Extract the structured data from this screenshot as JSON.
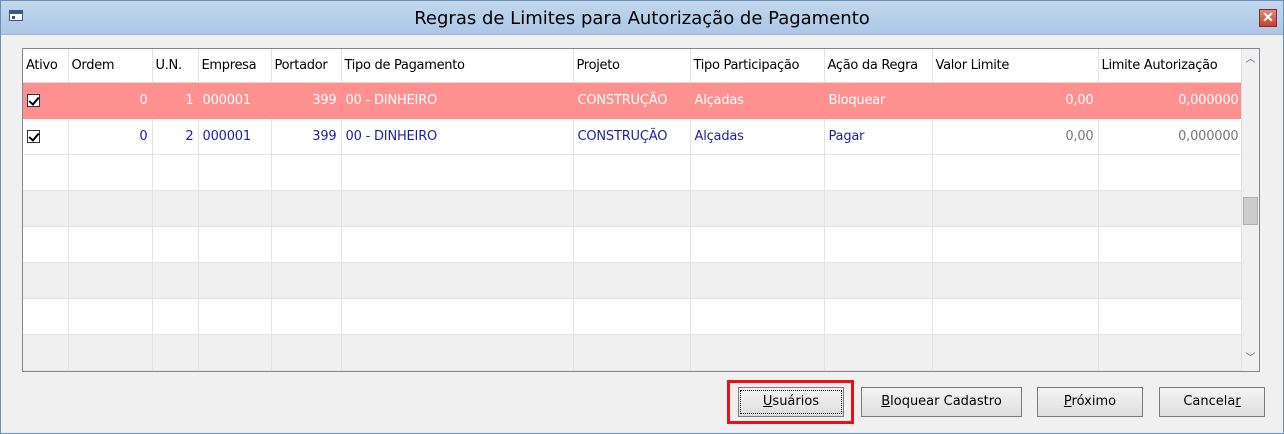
{
  "window": {
    "title": "Regras de Limites para Autorização de Pagamento",
    "close_glyph": "✕"
  },
  "grid": {
    "columns": [
      "Ativo",
      "Ordem",
      "U.N.",
      "Empresa",
      "Portador",
      "Tipo de Pagamento",
      "Projeto",
      "Tipo Participação",
      "Ação da Regra",
      "Valor Limite",
      "Limite Autorização"
    ],
    "rows": [
      {
        "ativo": true,
        "ordem": "0",
        "un": "1",
        "empresa": "000001",
        "portador": "399",
        "tipo_pagamento": "00 - DINHEIRO",
        "projeto": "CONSTRUÇÃO",
        "tipo_participacao": "Alçadas",
        "acao_regra": "Bloquear",
        "valor_limite": "0,00",
        "limite_autorizacao": "0,000000",
        "selected": true
      },
      {
        "ativo": true,
        "ordem": "0",
        "un": "2",
        "empresa": "000001",
        "portador": "399",
        "tipo_pagamento": "00 - DINHEIRO",
        "projeto": "CONSTRUÇÃO",
        "tipo_participacao": "Alçadas",
        "acao_regra": "Pagar",
        "valor_limite": "0,00",
        "limite_autorizacao": "0,000000",
        "selected": false
      }
    ],
    "selected_row_color": "#ff9090",
    "scroll": {
      "up_glyph": "︿",
      "down_glyph": "﹀"
    }
  },
  "buttons": {
    "usuarios": {
      "mnemonic": "U",
      "rest": "suários"
    },
    "bloquear": {
      "mnemonic": "B",
      "rest": "loquear Cadastro"
    },
    "proximo": {
      "mnemonic": "P",
      "rest": "róximo"
    },
    "cancelar": {
      "pre": "Cancela",
      "mnemonic": "r"
    }
  },
  "highlight_color": "#e8101a"
}
